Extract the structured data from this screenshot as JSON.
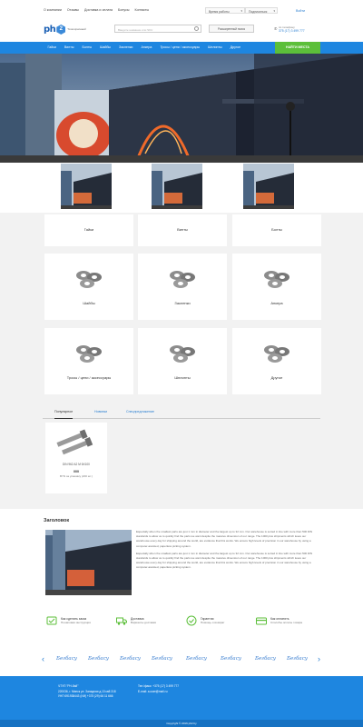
{
  "topbar": {
    "links": [
      "О компании",
      "Отзывы",
      "Доставка и оплата",
      "Бонусы",
      "Контакты"
    ],
    "work_mode": "Время работы",
    "subscribe": "Подписаться",
    "login": "Войти"
  },
  "header": {
    "logo_text": "ph",
    "logo_badge": "2",
    "logo_tagline": "Точки крепежей",
    "search_placeholder": "Введите название или SKU",
    "advanced_search": "Расширенный поиск",
    "phone_label": "по телефону",
    "phone": "375 (17) 3 499 777"
  },
  "nav": {
    "items": [
      "Гайки",
      "Винты",
      "Болты",
      "Шайбы",
      "Заклепки",
      "Анкера",
      "Тросы / цепи / аксессуары",
      "Шплинты",
      "Другое"
    ],
    "cta": "НАЙТИ МЕСТА"
  },
  "categories": [
    {
      "label": "Гайки"
    },
    {
      "label": "Винты"
    },
    {
      "label": "Болты"
    },
    {
      "label": "Шайбы"
    },
    {
      "label": "Заклепки"
    },
    {
      "label": "Анкера"
    },
    {
      "label": "Тросы / цепи / аксессуары"
    },
    {
      "label": "Шплинты"
    },
    {
      "label": "Другое"
    }
  ],
  "tabs": [
    "Популярное",
    "Новинки",
    "Спецпредложение"
  ],
  "product": {
    "code": "DIN 962 A2 M 6X100",
    "price": "000",
    "unit": "BYN за упаковку (200 шт.)"
  },
  "about": {
    "title": "Заголовок",
    "paragraph1": "Especially when the smallest parts are just 1 mm in diameter and the largest up to 32 mm. Our warehouse is sorted in line with more than 500 DIN standards to allow us to quickly find the parts we want despite the massive dimension of our range. The 1000 plus shipments which leave our warehouse every day for shipping around the world, are evidence that this works. We ensure high levels of precision in our warehouse by using a computer-assisted, paperless picking system.",
    "paragraph2": "Especially when the smallest parts are just 1 mm in diameter and the largest up to 32 mm. Our warehouse is sorted in line with more than 500 DIN standards to allow us to quickly find the parts we want despite the massive dimension of our range. The 1000 plus shipments which leave our warehouse every day for shipping around the world, are evidence that this works. We ensure high levels of precision in our warehouse by using a computer-assisted, paperless picking system."
  },
  "features": [
    {
      "title": "Как сделать заказ",
      "sub": "Пошаговая инструкция",
      "icon": "order-icon"
    },
    {
      "title": "Доставка",
      "sub": "Варианты доставки",
      "icon": "truck-icon"
    },
    {
      "title": "Гарантия",
      "sub": "Помощь и возврат",
      "icon": "guarantee-icon"
    },
    {
      "title": "Как оплатить",
      "sub": "Способы оплаты товара",
      "icon": "payment-icon"
    }
  ],
  "brands": [
    "Бегбасу",
    "Бегбасу",
    "Бегбасу",
    "Бегбасу",
    "Бегбасу",
    "Бегбасу",
    "Бегбасу",
    "Бегбасу"
  ],
  "footer": {
    "company": "ЧТУП \"PH-бай\"",
    "address": "220036, г. Минск ул. Западная д.13 кв8 318",
    "unp": "УНП 691938443 (ИИ)  +375 (29) 66 11 666",
    "phone": "Тел./факс: +375 (17) 3 499 777",
    "email": "E-mail: a.user@mail.ru",
    "copyright": "Copyright © 2016 ph2.by"
  },
  "colors": {
    "primary": "#1e86e0",
    "cta": "#5cbf3a",
    "footer_bottom": "#1672c2"
  }
}
